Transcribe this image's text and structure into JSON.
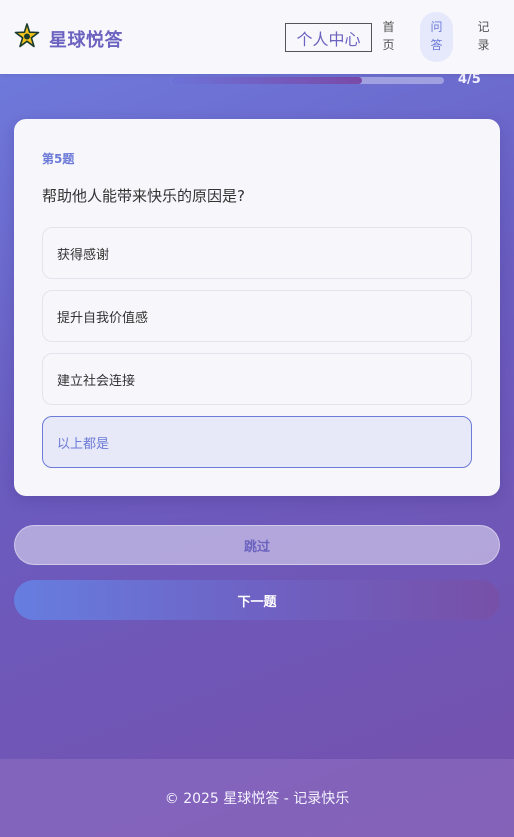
{
  "header": {
    "brand": "星球悦答",
    "profile_label": "个人中心",
    "nav": [
      {
        "label": "首页"
      },
      {
        "label": "问答"
      },
      {
        "label": "记录"
      }
    ],
    "logo_icon": "star-icon"
  },
  "progress": {
    "text": "4/5",
    "fraction": 0.7
  },
  "question": {
    "number": "第5题",
    "text": "帮助他人能带来快乐的原因是?",
    "options": [
      {
        "label": "获得感谢",
        "selected": false
      },
      {
        "label": "提升自我价值感",
        "selected": false
      },
      {
        "label": "建立社会连接",
        "selected": false
      },
      {
        "label": "以上都是",
        "selected": true
      }
    ]
  },
  "actions": {
    "skip_label": "跳过",
    "next_label": "下一题"
  },
  "footer": {
    "text": "© 2025 星球悦答 - 记录快乐"
  },
  "colors": {
    "accent": "#6c7ad8",
    "brand": "#6c63c0",
    "bg_start": "#6f7fe0",
    "bg_end": "#7650ac"
  }
}
